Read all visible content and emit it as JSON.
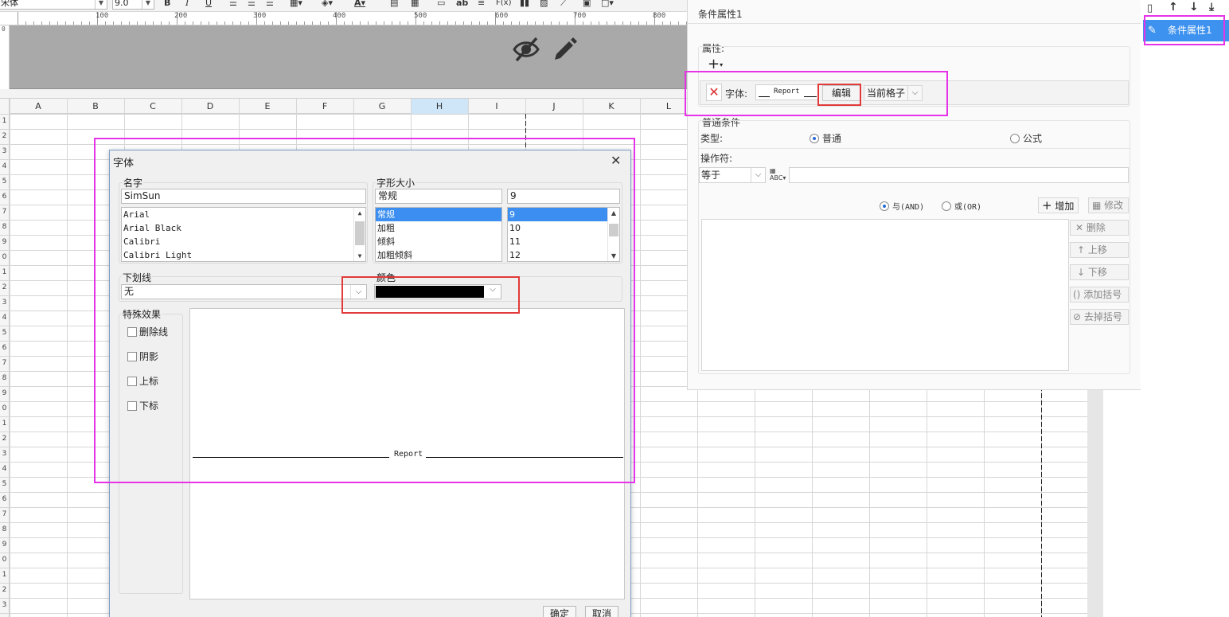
{
  "toolbar": {
    "font_name": "宋体",
    "font_size": "9.0",
    "bold": "B",
    "italic": "I",
    "underline": "U",
    "text_color_letter": "A",
    "ab": "ab",
    "formula": "F(x)"
  },
  "ruler": {
    "marks": [
      "100",
      "200",
      "300",
      "400",
      "500",
      "600",
      "700",
      "800"
    ],
    "left_mark": "0"
  },
  "sheet": {
    "columns": [
      "A",
      "B",
      "C",
      "D",
      "E",
      "F",
      "G",
      "H",
      "I",
      "J",
      "K",
      "L"
    ],
    "selected_column": "H",
    "row_numbers": [
      "1",
      "2",
      "3",
      "4",
      "5",
      "6",
      "7",
      "8",
      "9",
      "0",
      "1",
      "2",
      "3",
      "4",
      "5",
      "6",
      "7",
      "8",
      "9",
      "0",
      "1",
      "2",
      "3",
      "4",
      "5",
      "6",
      "7",
      "8",
      "9",
      "0",
      "1",
      "2",
      "3"
    ]
  },
  "font_dialog": {
    "title": "字体",
    "name_label": "名字",
    "name_value": "SimSun",
    "font_list": [
      "Arial",
      "Arial Black",
      "Calibri",
      "Calibri Light"
    ],
    "style_label": "字形大小",
    "style_value": "常规",
    "style_list": [
      "常规",
      "加粗",
      "倾斜",
      "加粗倾斜"
    ],
    "style_selected_index": 0,
    "size_value": "9",
    "size_list": [
      "9",
      "10",
      "11",
      "12"
    ],
    "size_selected_index": 0,
    "underline_label": "下划线",
    "underline_value": "无",
    "color_label": "颜色",
    "color_value": "#000000",
    "effects_label": "特殊效果",
    "effects": [
      "删除线",
      "阴影",
      "上标",
      "下标"
    ],
    "preview_text": "Report",
    "ok_button": "确定",
    "cancel_button": "取消"
  },
  "condition_panel": {
    "title": "条件属性1",
    "properties_label": "属性:",
    "add_symbol": "+",
    "prop_type": "字体:",
    "prop_preview": "Report",
    "edit_button": "编辑",
    "scope_value": "当前格子",
    "normal_condition_label": "普通条件",
    "type_label": "类型:",
    "type_normal": "普通",
    "type_formula": "公式",
    "operator_label": "操作符:",
    "operator_value": "等于",
    "and_label": "与(AND)",
    "or_label": "或(OR)",
    "add_button": "增加",
    "modify_button": "修改",
    "delete_button": "删除",
    "move_up_button": "上移",
    "move_down_button": "下移",
    "add_bracket_button": "添加括号",
    "remove_bracket_button": "去掉括号"
  },
  "condition_list": {
    "items": [
      "条件属性1"
    ]
  }
}
